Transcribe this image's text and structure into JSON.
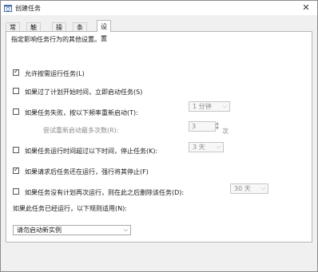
{
  "window": {
    "title": "创建任务",
    "close_glyph": "✕"
  },
  "tabs": [
    "常规",
    "触发器",
    "操作",
    "条件",
    "设置"
  ],
  "settings": {
    "description": "指定影响任务行为的其他设置。",
    "allow_on_demand": {
      "label": "允许按需运行任务(L)",
      "checked": true
    },
    "run_asap_missed": {
      "label": "如果过了计划开始时间，立即启动任务(S)",
      "checked": false
    },
    "restart_on_fail": {
      "label": "如果任务失败，按以下频率重新启动(T):",
      "checked": false,
      "interval": "1 分钟"
    },
    "restart_attempts": {
      "label": "尝试重新启动最多次数(R):",
      "value": "3",
      "unit": "次"
    },
    "stop_if_runs_longer": {
      "label": "如果任务运行时间超过以下时间，停止任务(K):",
      "checked": false,
      "duration": "3 天"
    },
    "force_stop": {
      "label": "如果请求后任务还在运行，强行将其停止(F)",
      "checked": true
    },
    "delete_if_not_scheduled": {
      "label": "如果任务没有计划再次运行，则在此之后删除该任务(D):",
      "checked": false,
      "after": "30 天"
    },
    "already_running": {
      "label": "如果此任务已经运行，以下规则适用(N):",
      "rule": "请勿启动新实例"
    }
  },
  "icons": {
    "dropdown": "chevron-down-icon",
    "checkbox_check": "checkmark-icon",
    "app": "task-scheduler-icon"
  }
}
